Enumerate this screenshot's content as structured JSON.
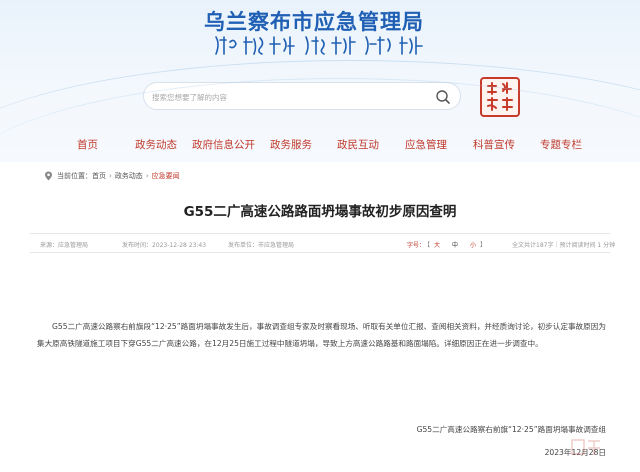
{
  "site": {
    "title": "乌兰察布市应急管理局"
  },
  "search": {
    "placeholder": "搜索您想要了解的内容"
  },
  "nav": {
    "items": [
      "首页",
      "政务动态",
      "政府信息公开",
      "政务服务",
      "政民互动",
      "应急管理",
      "科普宣传",
      "专题专栏"
    ]
  },
  "breadcrumb": {
    "label": "当前位置：",
    "items": [
      "首页",
      "政务动态",
      "应急要闻"
    ]
  },
  "article": {
    "title": "G55二广高速公路路面坍塌事故初步原因查明",
    "meta": {
      "source": "来源：应急管理局",
      "time": "发布时间：2023-12-28 23:43",
      "publisher": "发布单位：市应急管理局",
      "font_label": "字号：",
      "font_open": "【",
      "font_large": "大",
      "font_medium": "中",
      "font_small": "小",
      "font_close": "】",
      "word_count": "全文共计187字｜预计阅读时间 1 分钟"
    },
    "body": "G55二广高速公路察右前旗段“12·25”路面坍塌事故发生后，事故调查组专家及时察看现场、听取有关单位汇报、查阅相关资料，并经质询讨论，初步认定事故原因为集大原高铁隧道施工项目下穿G55二广高速公路，在12月25日施工过程中隧道坍塌，导致上方高速公路路基和路面塌陷。详细原因正在进一步调查中。",
    "signature_org": "G55二广高速公路察右前旗“12·25”路面坍塌事故调查组",
    "signature_date": "2023年12月28日"
  },
  "colors": {
    "brand_blue": "#1f5fb4",
    "nav_red": "#c0392b",
    "seal_red": "#c83a2a"
  },
  "icons": {
    "search": "magnifier-icon",
    "location": "location-pin-icon",
    "seal": "red-seal-icon"
  }
}
